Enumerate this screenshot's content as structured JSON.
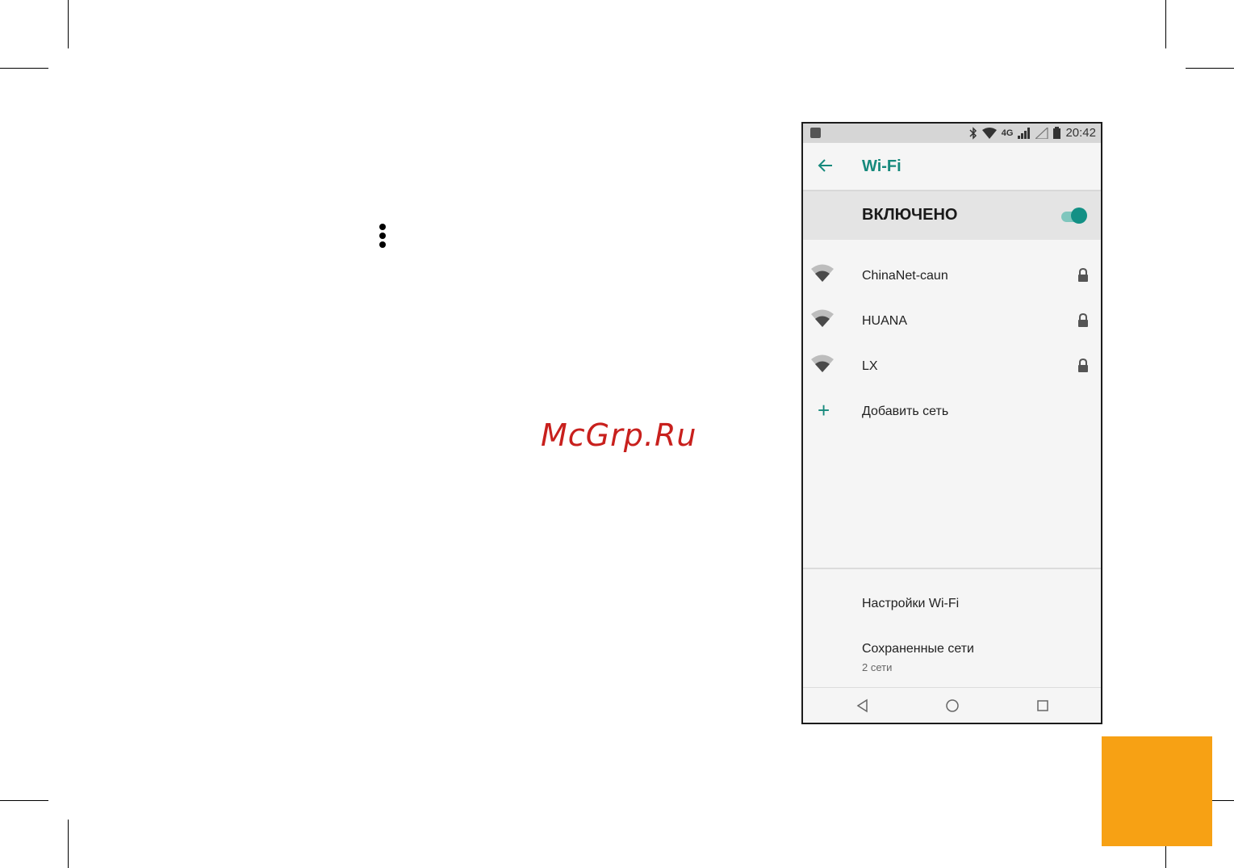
{
  "watermark": "McGrp.Ru",
  "statusbar": {
    "network_label": "4G",
    "time": "20:42",
    "icons": [
      "image-icon",
      "bluetooth-icon",
      "wifi-signal-icon",
      "cellular-signal-icon",
      "no-sim-icon",
      "battery-icon"
    ]
  },
  "appbar": {
    "title": "Wi-Fi"
  },
  "wifi_toggle": {
    "label": "ВКЛЮЧЕНО",
    "on": true
  },
  "networks": [
    {
      "name": "ChinaNet-caun",
      "secured": true
    },
    {
      "name": "HUANA",
      "secured": true
    },
    {
      "name": "LX",
      "secured": true
    }
  ],
  "add_network": {
    "label": "Добавить сеть"
  },
  "settings": {
    "wifi_settings": "Настройки Wi-Fi",
    "saved_networks": "Сохраненные сети",
    "saved_networks_count": "2 сети"
  },
  "colors": {
    "accent": "#16897c",
    "page_orange": "#f7a114",
    "watermark": "#c8201d"
  }
}
